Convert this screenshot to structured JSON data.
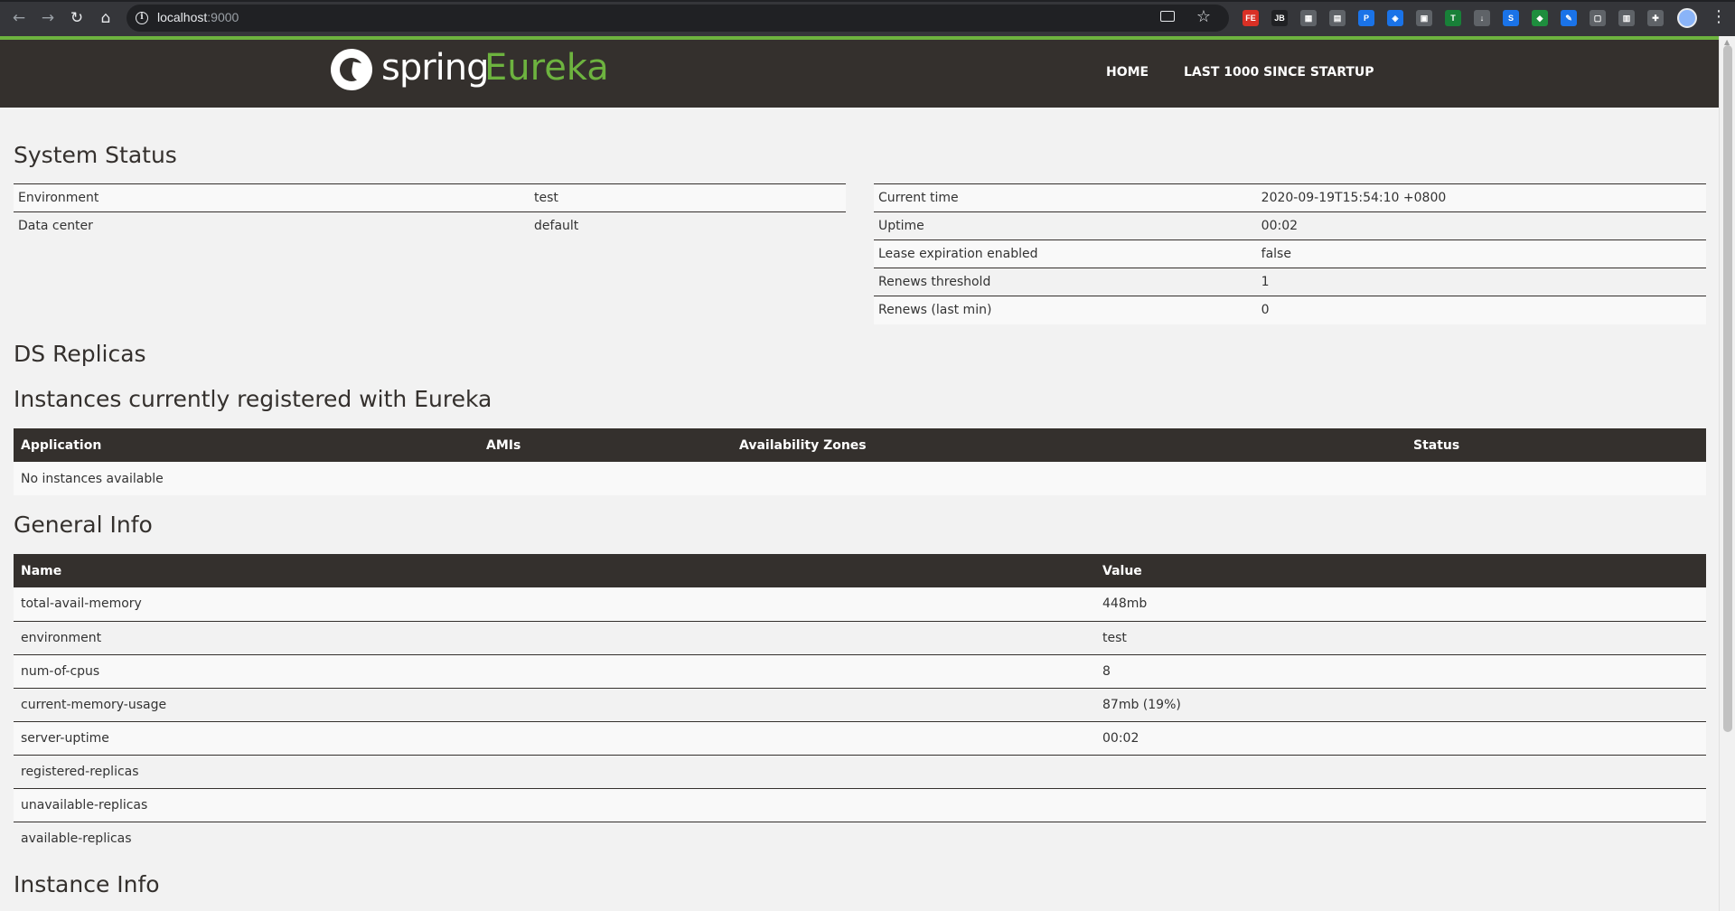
{
  "browser": {
    "url_host": "localhost",
    "url_port": ":9000",
    "extensions": [
      {
        "name": "fe-extension-icon",
        "text": "FE",
        "color": "#d93025"
      },
      {
        "name": "jb-extension-icon",
        "text": "JB",
        "color": "#202124"
      },
      {
        "name": "grid-extension-icon",
        "text": "▦",
        "color": "#5f6368"
      },
      {
        "name": "ext-4-icon",
        "text": "▤",
        "color": "#5f6368"
      },
      {
        "name": "p-extension-icon",
        "text": "P",
        "color": "#1a73e8"
      },
      {
        "name": "ext-6-icon",
        "text": "◈",
        "color": "#1a73e8"
      },
      {
        "name": "ext-7-icon",
        "text": "▣",
        "color": "#5f6368"
      },
      {
        "name": "t-extension-icon",
        "text": "T",
        "color": "#188038"
      },
      {
        "name": "download-extension-icon",
        "text": "↓",
        "color": "#5f6368"
      },
      {
        "name": "s-extension-icon",
        "text": "S",
        "color": "#1a73e8"
      },
      {
        "name": "tag-extension-icon",
        "text": "◆",
        "color": "#1e8e3e"
      },
      {
        "name": "pen-extension-icon",
        "text": "✎",
        "color": "#1a73e8"
      },
      {
        "name": "ext-13-icon",
        "text": "▢",
        "color": "#5f6368"
      },
      {
        "name": "ext-14-icon",
        "text": "▥",
        "color": "#5f6368"
      },
      {
        "name": "puzzle-extension-icon",
        "text": "✚",
        "color": "#5f6368"
      }
    ]
  },
  "header": {
    "logo_spring": "spring",
    "logo_eureka": "Eureka",
    "nav": [
      "HOME",
      "LAST 1000 SINCE STARTUP"
    ]
  },
  "system_status": {
    "title": "System Status",
    "left": [
      {
        "key": "Environment",
        "value": "test"
      },
      {
        "key": "Data center",
        "value": "default"
      }
    ],
    "right": [
      {
        "key": "Current time",
        "value": "2020-09-19T15:54:10 +0800"
      },
      {
        "key": "Uptime",
        "value": "00:02"
      },
      {
        "key": "Lease expiration enabled",
        "value": "false"
      },
      {
        "key": "Renews threshold",
        "value": "1"
      },
      {
        "key": "Renews (last min)",
        "value": "0"
      }
    ]
  },
  "ds_replicas": {
    "title": "DS Replicas"
  },
  "instances": {
    "title": "Instances currently registered with Eureka",
    "columns": [
      "Application",
      "AMIs",
      "Availability Zones",
      "Status"
    ],
    "empty_text": "No instances available"
  },
  "general_info": {
    "title": "General Info",
    "columns": [
      "Name",
      "Value"
    ],
    "rows": [
      {
        "name": "total-avail-memory",
        "value": "448mb"
      },
      {
        "name": "environment",
        "value": "test"
      },
      {
        "name": "num-of-cpus",
        "value": "8"
      },
      {
        "name": "current-memory-usage",
        "value": "87mb (19%)"
      },
      {
        "name": "server-uptime",
        "value": "00:02"
      },
      {
        "name": "registered-replicas",
        "value": ""
      },
      {
        "name": "unavailable-replicas",
        "value": ""
      },
      {
        "name": "available-replicas",
        "value": ""
      }
    ]
  },
  "instance_info": {
    "title": "Instance Info"
  }
}
